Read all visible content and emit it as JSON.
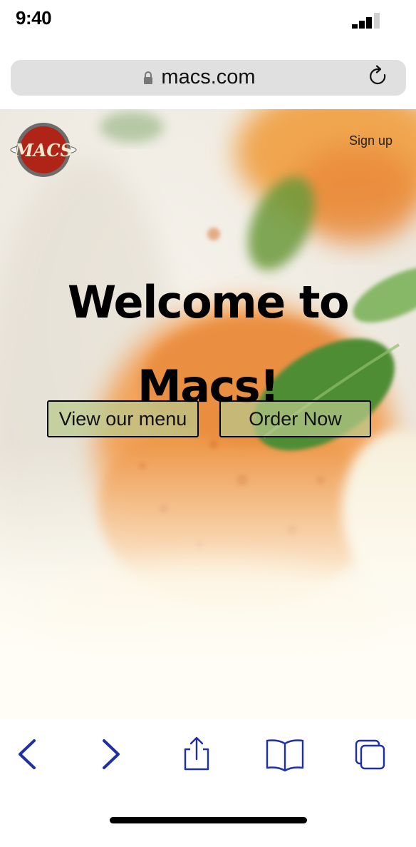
{
  "status_bar": {
    "time": "9:40"
  },
  "browser": {
    "url": "macs.com"
  },
  "site": {
    "logo_text": "MACS",
    "nav": {
      "signup_label": "Sign up"
    },
    "hero": {
      "title": "Welcome to Macs!",
      "buttons": {
        "menu_label": "View our menu",
        "order_label": "Order Now"
      }
    }
  },
  "toolbar": {
    "icons": [
      "back-icon",
      "forward-icon",
      "share-icon",
      "bookmarks-icon",
      "tabs-icon"
    ]
  },
  "colors": {
    "toolbar_icon": "#1f2fa6",
    "button_fill": "#b8c98c",
    "logo_red": "#b02418"
  }
}
